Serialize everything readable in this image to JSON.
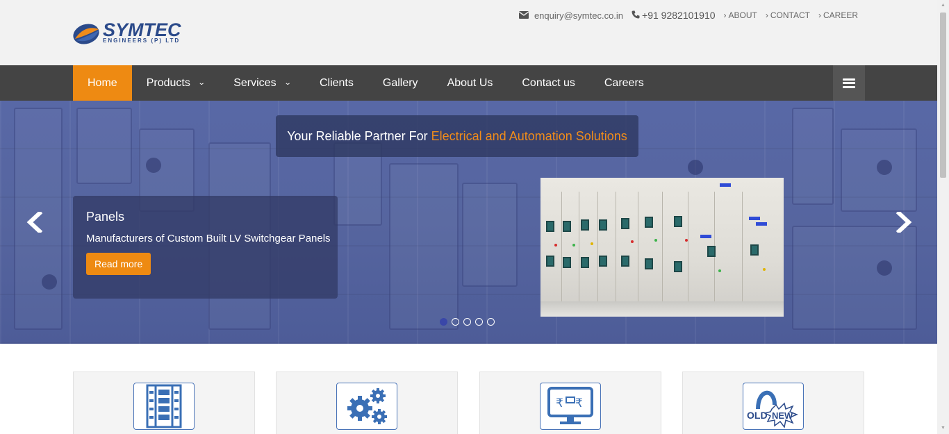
{
  "brand": {
    "name": "SYMTEC",
    "subtitle": "ENGINEERS (P) LTD"
  },
  "topbar": {
    "email": "enquiry@symtec.co.in",
    "phone": "+91 9282101910",
    "links": [
      "ABOUT",
      "CONTACT",
      "CAREER"
    ]
  },
  "nav": {
    "items": [
      {
        "label": "Home",
        "active": true
      },
      {
        "label": "Products",
        "dropdown": true
      },
      {
        "label": "Services",
        "dropdown": true
      },
      {
        "label": "Clients"
      },
      {
        "label": "Gallery"
      },
      {
        "label": "About Us"
      },
      {
        "label": "Contact us"
      },
      {
        "label": "Careers"
      }
    ]
  },
  "hero": {
    "tagline_prefix": "Your Reliable Partner For",
    "tagline_highlight": "Electrical and Automation Solutions",
    "slide_title": "Panels",
    "slide_description": "Manufacturers of Custom Built LV Switchgear Panels",
    "read_more": "Read more",
    "slide_count": 5,
    "active_slide": 1
  },
  "features": {
    "icons": [
      "panel-board-icon",
      "gears-icon",
      "rupee-monitor-icon",
      "old-new-icon"
    ],
    "old_label": "OLD",
    "new_label": "NEW",
    "rupee": "₹"
  },
  "colors": {
    "accent": "#ee8a12",
    "nav_bg": "#444444",
    "brand_blue": "#2b4a8a",
    "hero_overlay": "#56659f"
  }
}
